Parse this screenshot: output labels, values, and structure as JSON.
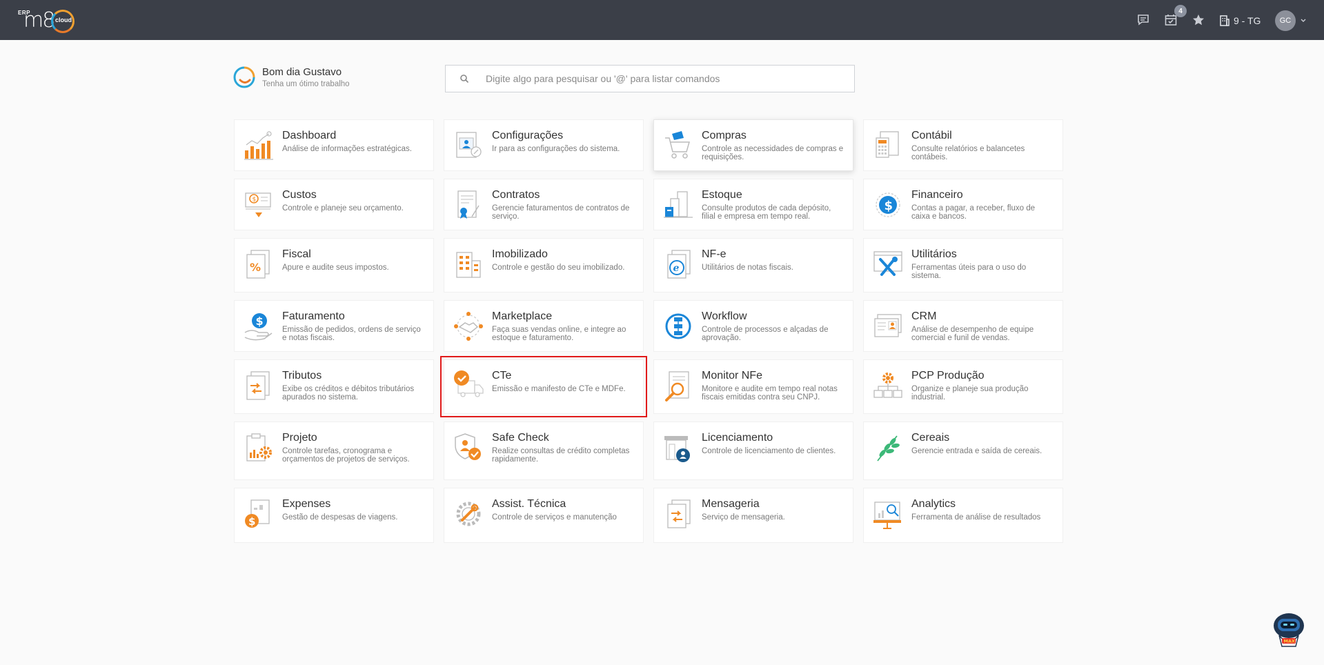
{
  "header": {
    "logo_prefix": "ERP",
    "logo_main": "m8",
    "logo_suffix": "cloud",
    "notification_count": "4",
    "company": "9 - TG",
    "avatar_initials": "GC"
  },
  "greeting": {
    "title": "Bom dia Gustavo",
    "subtitle": "Tenha um ótimo trabalho"
  },
  "search": {
    "placeholder": "Digite algo para pesquisar ou '@' para listar comandos"
  },
  "modules": [
    {
      "title": "Dashboard",
      "desc": "Análise de informações estratégicas.",
      "icon": "bar-chart-icon"
    },
    {
      "title": "Configurações",
      "desc": "Ir para as configurações do sistema.",
      "icon": "settings-profile-icon"
    },
    {
      "title": "Compras",
      "desc": "Controle as necessidades de compras e requisições.",
      "icon": "shopping-cart-icon"
    },
    {
      "title": "Contábil",
      "desc": "Consulte relatórios e balancetes contábeis.",
      "icon": "calculator-document-icon"
    },
    {
      "title": "Custos",
      "desc": "Controle e planeje seu orçamento.",
      "icon": "cost-money-icon"
    },
    {
      "title": "Contratos",
      "desc": "Gerencie faturamentos de contratos de serviço.",
      "icon": "contract-icon"
    },
    {
      "title": "Estoque",
      "desc": "Consulte produtos de cada depósito, filial e empresa em tempo real.",
      "icon": "warehouse-icon"
    },
    {
      "title": "Financeiro",
      "desc": "Contas a pagar, a receber, fluxo de caixa e bancos.",
      "icon": "dollar-coin-icon"
    },
    {
      "title": "Fiscal",
      "desc": "Apure e audite seus impostos.",
      "icon": "percent-document-icon"
    },
    {
      "title": "Imobilizado",
      "desc": "Controle e gestão do seu imobilizado.",
      "icon": "building-icon"
    },
    {
      "title": "NF-e",
      "desc": "Utilitários de notas fiscais.",
      "icon": "electronic-invoice-icon"
    },
    {
      "title": "Utilitários",
      "desc": "Ferramentas úteis para o uso do sistema.",
      "icon": "tools-icon"
    },
    {
      "title": "Faturamento",
      "desc": "Emissão de pedidos, ordens de serviço e notas fiscais.",
      "icon": "billing-hand-icon"
    },
    {
      "title": "Marketplace",
      "desc": "Faça suas vendas online, e integre ao estoque e faturamento.",
      "icon": "handshake-icon"
    },
    {
      "title": "Workflow",
      "desc": "Controle de processos e alçadas de aprovação.",
      "icon": "workflow-icon"
    },
    {
      "title": "CRM",
      "desc": "Análise de desempenho de equipe comercial e funil de vendas.",
      "icon": "crm-profile-icon"
    },
    {
      "title": "Tributos",
      "desc": "Exibe os créditos e débitos tributários apurados no sistema.",
      "icon": "tax-transfer-icon"
    },
    {
      "title": "CTe",
      "desc": "Emissão e manifesto de CTe e MDFe.",
      "icon": "truck-check-icon"
    },
    {
      "title": "Monitor NFe",
      "desc": "Monitore e audite em tempo real notas fiscais emitidas contra seu CNPJ.",
      "icon": "magnifier-document-icon"
    },
    {
      "title": "PCP Produção",
      "desc": "Organize e planeje sua produção industrial.",
      "icon": "production-gear-icon"
    },
    {
      "title": "Projeto",
      "desc": "Controle tarefas, cronograma e orçamentos de projetos de serviços.",
      "icon": "project-clipboard-icon"
    },
    {
      "title": "Safe Check",
      "desc": "Realize consultas de crédito completas rapidamente.",
      "icon": "shield-check-icon"
    },
    {
      "title": "Licenciamento",
      "desc": "Controle de licenciamento de clientes.",
      "icon": "license-store-icon"
    },
    {
      "title": "Cereais",
      "desc": "Gerencie entrada e saída de cereais.",
      "icon": "wheat-icon"
    },
    {
      "title": "Expenses",
      "desc": "Gestão de despesas de viagens.",
      "icon": "expenses-icon"
    },
    {
      "title": "Assist. Técnica",
      "desc": "Controle de serviços e manutenção",
      "icon": "wrench-gear-icon"
    },
    {
      "title": "Mensageria",
      "desc": "Serviço de mensageria.",
      "icon": "messaging-document-icon"
    },
    {
      "title": "Analytics",
      "desc": "Ferramenta de análise de resultados",
      "icon": "analytics-board-icon"
    }
  ],
  "colors": {
    "topbar": "#3b3f48",
    "accent_orange": "#f08a24",
    "accent_blue": "#1a86d8",
    "selection": "#e11a1a"
  }
}
